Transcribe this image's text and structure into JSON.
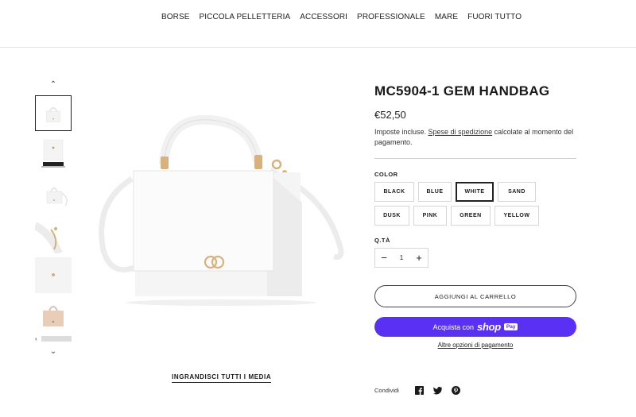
{
  "nav": {
    "items": [
      {
        "label": "BORSE"
      },
      {
        "label": "PICCOLA PELLETTERIA"
      },
      {
        "label": "ACCESSORI"
      },
      {
        "label": "PROFESSIONALE"
      },
      {
        "label": "MARE"
      },
      {
        "label": "FUORI TUTTO"
      }
    ]
  },
  "gallery": {
    "up_icon": "chevron-up-icon",
    "down_icon": "chevron-down-icon",
    "zoom_label": "INGRANDISCI TUTTI I MEDIA"
  },
  "product": {
    "title": "MC5904-1 GEM HANDBAG",
    "price": "€52,50",
    "tax_prefix": "Imposte incluse.",
    "tax_link": "Spese di spedizione",
    "tax_suffix": "calcolate al momento del pagamento.",
    "color_label": "COLOR",
    "colors": [
      {
        "label": "BLACK"
      },
      {
        "label": "BLUE"
      },
      {
        "label": "WHITE",
        "selected": true
      },
      {
        "label": "SAND"
      },
      {
        "label": "DUSK"
      },
      {
        "label": "PINK"
      },
      {
        "label": "GREEN"
      },
      {
        "label": "YELLOW"
      }
    ],
    "qty_label": "Q.TÀ",
    "qty_minus": "−",
    "qty_value": "1",
    "qty_plus": "+",
    "add_to_cart": "AGGIUNGI AL CARRELLO",
    "shop_pay_prefix": "Acquista con",
    "shop_pay_brand": "shop",
    "shop_pay_badge": "Pay",
    "more_payment": "Altre opzioni di pagamento",
    "share_label": "Condividi",
    "share_icons": [
      "facebook-icon",
      "twitter-icon",
      "pinterest-icon"
    ]
  },
  "colors": {
    "accent_shop_pay": "#5a31f4",
    "text": "#1a1a1a",
    "border": "#d6d6d6"
  }
}
